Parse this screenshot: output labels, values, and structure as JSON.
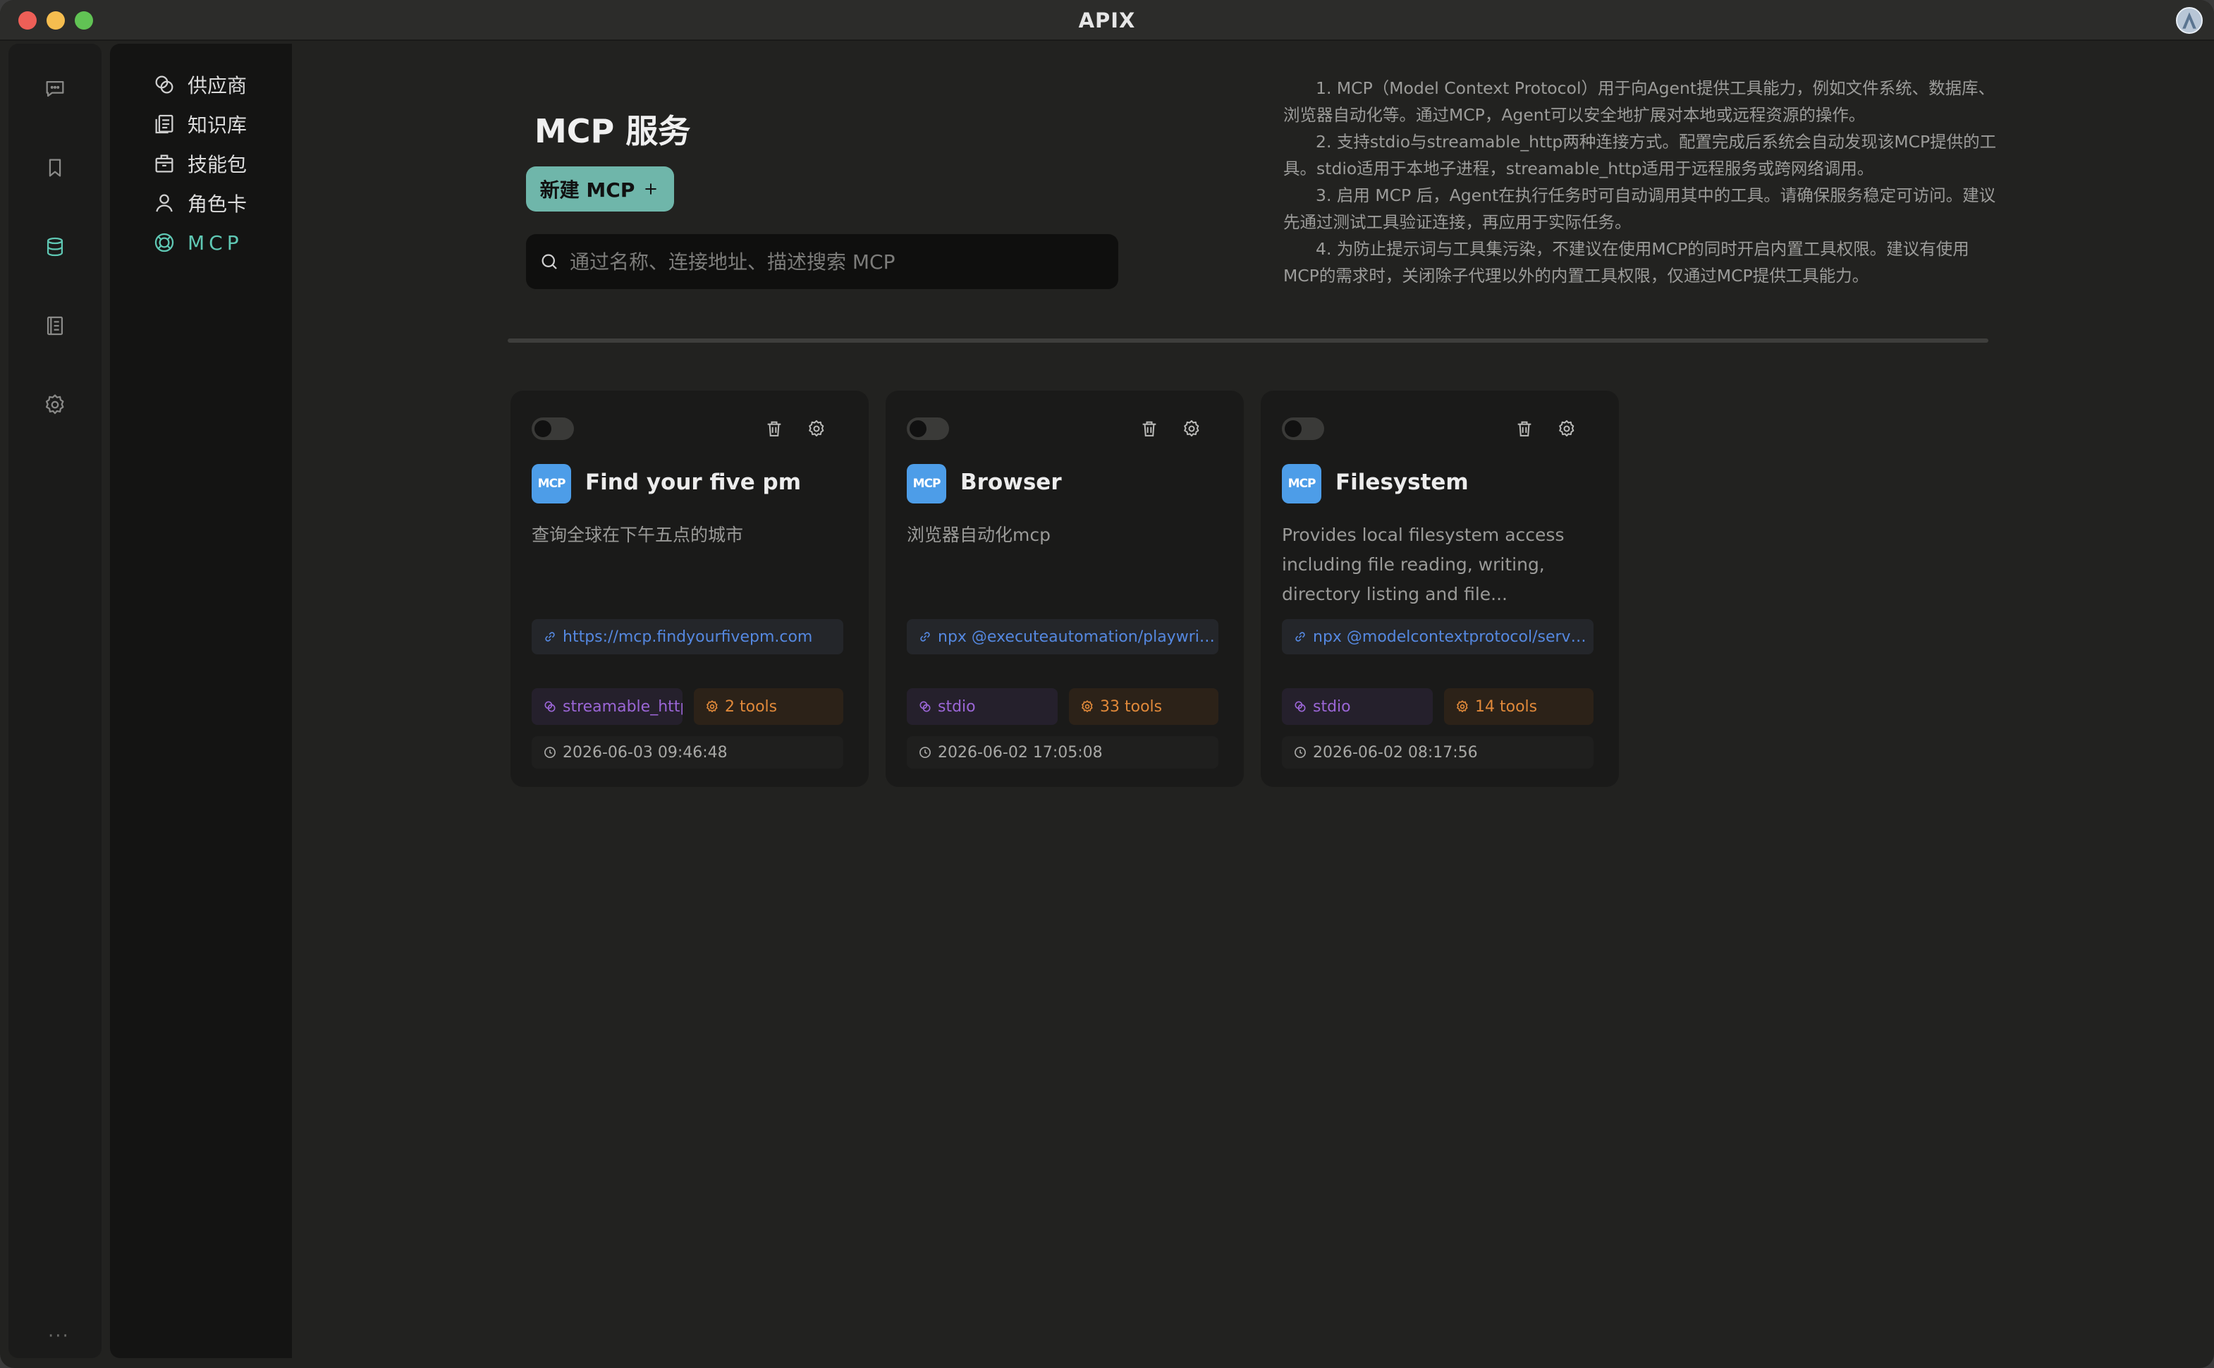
{
  "window": {
    "title": "APIX"
  },
  "subnav": {
    "items": [
      {
        "label": "供应商"
      },
      {
        "label": "知识库"
      },
      {
        "label": "技能包"
      },
      {
        "label": "角色卡"
      },
      {
        "label": "MCP"
      }
    ],
    "active": "MCP"
  },
  "header": {
    "title": "MCP 服务",
    "new_button_label": "新建 MCP",
    "search_placeholder": "通过名称、连接地址、描述搜索 MCP"
  },
  "info": [
    "1. MCP（Model Context Protocol）用于向Agent提供工具能力，例如文件系统、数据库、浏览器自动化等。通过MCP，Agent可以安全地扩展对本地或远程资源的操作。",
    "2. 支持stdio与streamable_http两种连接方式。配置完成后系统会自动发现该MCP提供的工具。stdio适用于本地子进程，streamable_http适用于远程服务或跨网络调用。",
    "3. 启用 MCP 后，Agent在执行任务时可自动调用其中的工具。请确保服务稳定可访问。建议先通过测试工具验证连接，再应用于实际任务。",
    "4. 为防止提示词与工具集污染，不建议在使用MCP的同时开启内置工具权限。建议有使用MCP的需求时，关闭除子代理以外的内置工具权限，仅通过MCP提供工具能力。"
  ],
  "cards": [
    {
      "badge": "MCP",
      "title": "Find your five pm",
      "description": "查询全球在下午五点的城市",
      "url": "https://mcp.findyourfivepm.com",
      "transport": "streamable_http",
      "tools": "2 tools",
      "timestamp": "2026-06-03 09:46:48",
      "enabled": false
    },
    {
      "badge": "MCP",
      "title": "Browser",
      "description": "浏览器自动化mcp",
      "url": "npx @executeautomation/playwright-mcp-server",
      "transport": "stdio",
      "tools": "33 tools",
      "timestamp": "2026-06-02 17:05:08",
      "enabled": false
    },
    {
      "badge": "MCP",
      "title": "Filesystem",
      "description": "Provides local filesystem access including file reading, writing, directory listing and file...",
      "url": "npx @modelcontextprotocol/server-filesystem",
      "transport": "stdio",
      "tools": "14 tools",
      "timestamp": "2026-06-02 08:17:56",
      "enabled": false
    }
  ],
  "colors": {
    "accent": "#5fc8b4",
    "button": "#6fb6aa",
    "badge": "#4d9de8",
    "link": "#5588e0",
    "transport": "#9b66d6",
    "tools": "#e0893a"
  },
  "icons": {
    "rail": [
      "chat-icon",
      "bookmark-icon",
      "database-icon",
      "notebook-icon",
      "settings-icon"
    ],
    "subnav": [
      "provider-icon",
      "knowledge-base-icon",
      "skill-package-icon",
      "role-card-icon",
      "mcp-icon"
    ]
  }
}
